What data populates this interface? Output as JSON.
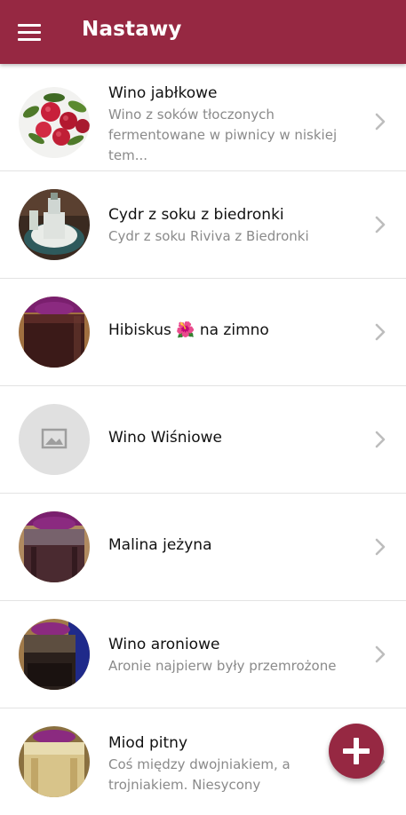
{
  "app_bar": {
    "title": "Nastawy",
    "menu_icon": "hamburger-menu-icon",
    "color": "#962842"
  },
  "items": [
    {
      "name": "Wino jabłkowe",
      "description": "Wino z soków tłoczonych fermentowane w piwnicy w niskiej tem...",
      "thumbnail": "apples-photo"
    },
    {
      "name": "Cydr z soku z biedronki",
      "description": "Cydr z soku Riviva z Biedronki",
      "thumbnail": "cider-jar-photo"
    },
    {
      "name": "Hibiskus",
      "emoji": "🌺",
      "name_suffix": "na zimno",
      "description": "",
      "thumbnail": "hibiscus-jar-photo"
    },
    {
      "name": "Wino Wiśniowe",
      "description": "",
      "thumbnail": "image-placeholder-icon"
    },
    {
      "name": "Malina jeżyna",
      "description": "",
      "thumbnail": "raspberry-jar-photo"
    },
    {
      "name": "Wino aroniowe",
      "description": "Aronie najpierw były przemrożone",
      "thumbnail": "aronia-jar-photo"
    },
    {
      "name": "Miod pitny",
      "description": "Coś między dwojniakiem, a trojniakiem. Niesycony",
      "thumbnail": "mead-jar-photo"
    }
  ],
  "fab": {
    "icon": "plus-icon",
    "color": "#962842"
  }
}
